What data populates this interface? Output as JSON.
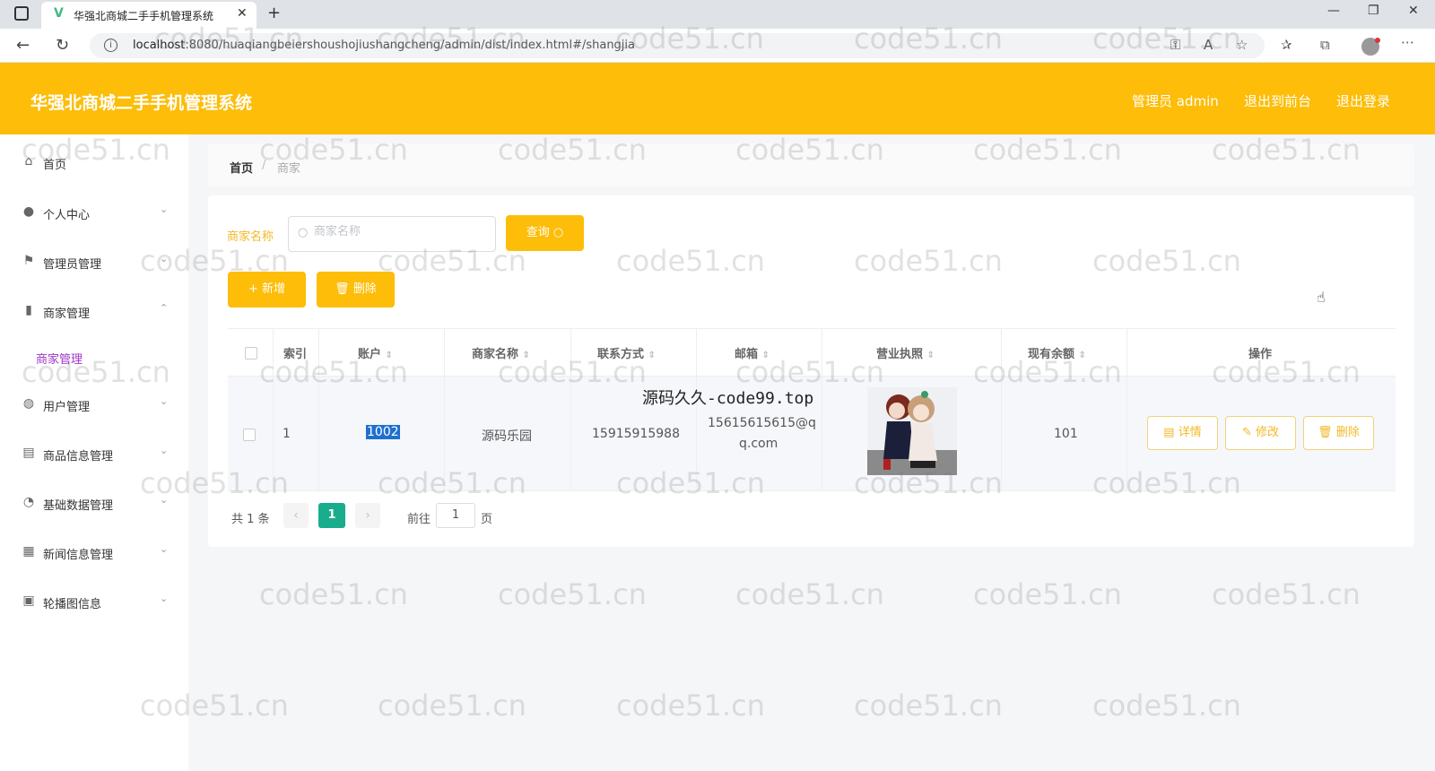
{
  "browser": {
    "tab_title": "华强北商城二手手机管理系统",
    "url_host": "localhost",
    "url_rest": ":8080/huaqiangbeiershoushojiushangcheng/admin/dist/index.html#/shangjia"
  },
  "header": {
    "title": "华强北商城二手手机管理系统",
    "links": [
      "管理员 admin",
      "退出到前台",
      "退出登录"
    ]
  },
  "sidebar": {
    "items": [
      {
        "label": "首页",
        "icon": "home-icon"
      },
      {
        "label": "个人中心",
        "icon": "user-icon"
      },
      {
        "label": "管理员管理",
        "icon": "flag-icon"
      },
      {
        "label": "商家管理",
        "icon": "bar-chart-icon"
      },
      {
        "label": "用户管理",
        "icon": "globe-icon"
      },
      {
        "label": "商品信息管理",
        "icon": "document-icon"
      },
      {
        "label": "基础数据管理",
        "icon": "compass-icon"
      },
      {
        "label": "新闻信息管理",
        "icon": "grid-icon"
      },
      {
        "label": "轮播图信息",
        "icon": "image-icon"
      }
    ],
    "submenu_active": "商家管理"
  },
  "breadcrumb": {
    "home": "首页",
    "sep": "/",
    "current": "商家"
  },
  "search": {
    "label": "商家名称",
    "placeholder": "商家名称",
    "button": "查询"
  },
  "actions": {
    "add": "+ 新增",
    "delete": "删除"
  },
  "table": {
    "headers": [
      "索引",
      "账户",
      "商家名称",
      "联系方式",
      "邮箱",
      "营业执照",
      "现有余额",
      "操作"
    ],
    "rows": [
      {
        "index": "1",
        "account": "1002",
        "name": "源码乐园",
        "phone": "15915915988",
        "email_line1": "15615615615@q",
        "email_line2": "q.com",
        "balance": "101",
        "ops": [
          "详情",
          "修改",
          "删除"
        ]
      }
    ]
  },
  "overlay_text": "源码久久-code99.top",
  "pagination": {
    "total": "共 1 条",
    "current_page": "1",
    "goto": "前往",
    "goto_value": "1",
    "page_suffix": "页",
    "prev": "‹",
    "next": "›"
  },
  "watermark": "code51.cn",
  "colors": {
    "header": "#fdbd08",
    "accent": "#f3b826",
    "active_page": "#1aad8d",
    "submenu": "#a036c8"
  }
}
